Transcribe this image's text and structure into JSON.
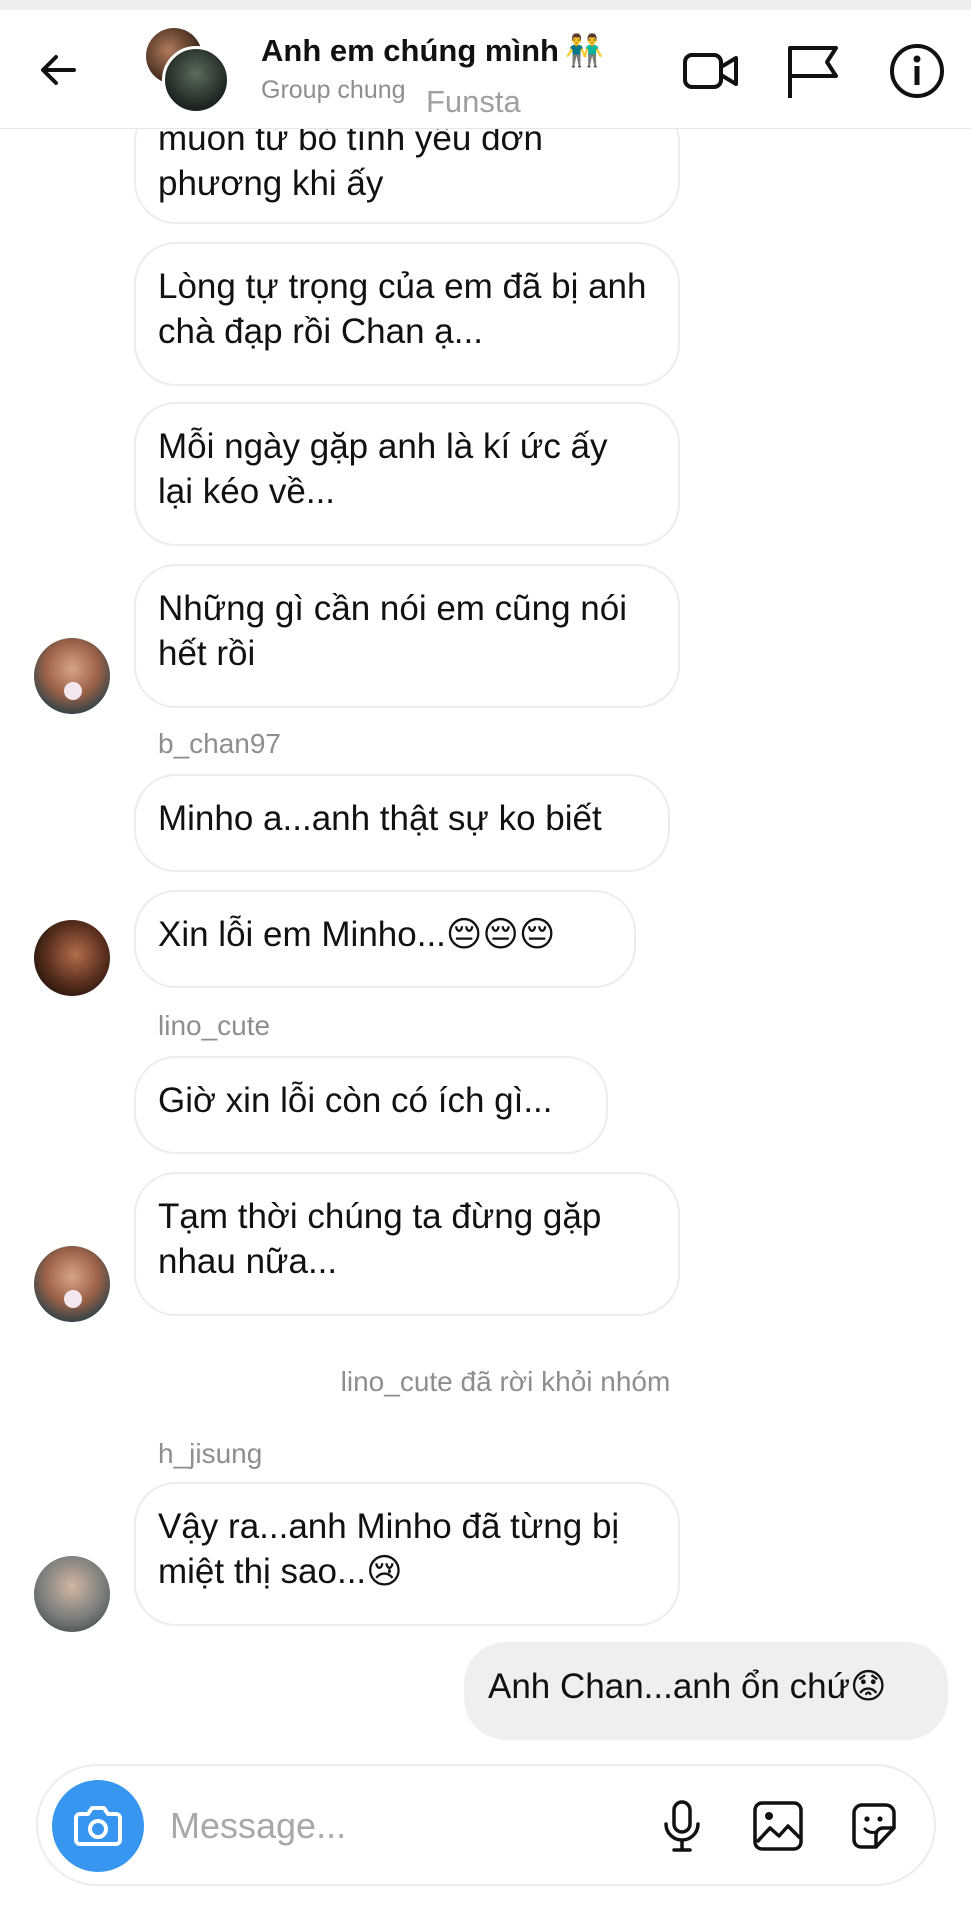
{
  "header": {
    "title": "Anh em chúng mình",
    "title_emoji": "👬",
    "subtitle": "Group chung",
    "watermark": "Funsta"
  },
  "messages": [
    {
      "text": "muốn từ bỏ tình yêu đơn phương khi ấy",
      "side": "left"
    },
    {
      "text": "Lòng tự trọng của em đã bị anh chà đạp rồi Chan ạ...",
      "side": "left"
    },
    {
      "text": "Mỗi ngày gặp anh là kí ức ấy lại kéo về...",
      "side": "left"
    },
    {
      "text": "Những gì cần nói em cũng nói hết rồi",
      "side": "left"
    },
    {
      "sender": "b_chan97"
    },
    {
      "text": "Minho a...anh thật sự ko biết",
      "side": "left"
    },
    {
      "text": "Xin lỗi em Minho...",
      "emoji": "😔😔😔",
      "side": "left"
    },
    {
      "sender": "lino_cute"
    },
    {
      "text": "Giờ xin lỗi còn có ích gì...",
      "side": "left"
    },
    {
      "text": "Tạm thời chúng ta đừng gặp nhau nữa...",
      "side": "left"
    },
    {
      "system": "lino_cute đã rời khỏi nhóm"
    },
    {
      "sender": "h_jisung"
    },
    {
      "text": "Vậy ra...anh Minho đã từng bị miệt thị sao...",
      "emoji": "😢",
      "side": "left"
    },
    {
      "text": "Anh Chan...anh ổn chứ",
      "emoji": "😟",
      "side": "right"
    }
  ],
  "composer": {
    "placeholder": "Message..."
  },
  "colors": {
    "accent": "#3797f0",
    "bubble_border": "#ececec",
    "own_bubble": "#efefef",
    "meta_text": "#8e8e8e"
  },
  "icons": [
    "back-arrow-icon",
    "video-call-icon",
    "flag-icon",
    "info-icon",
    "camera-icon",
    "microphone-icon",
    "gallery-icon",
    "sticker-icon"
  ]
}
